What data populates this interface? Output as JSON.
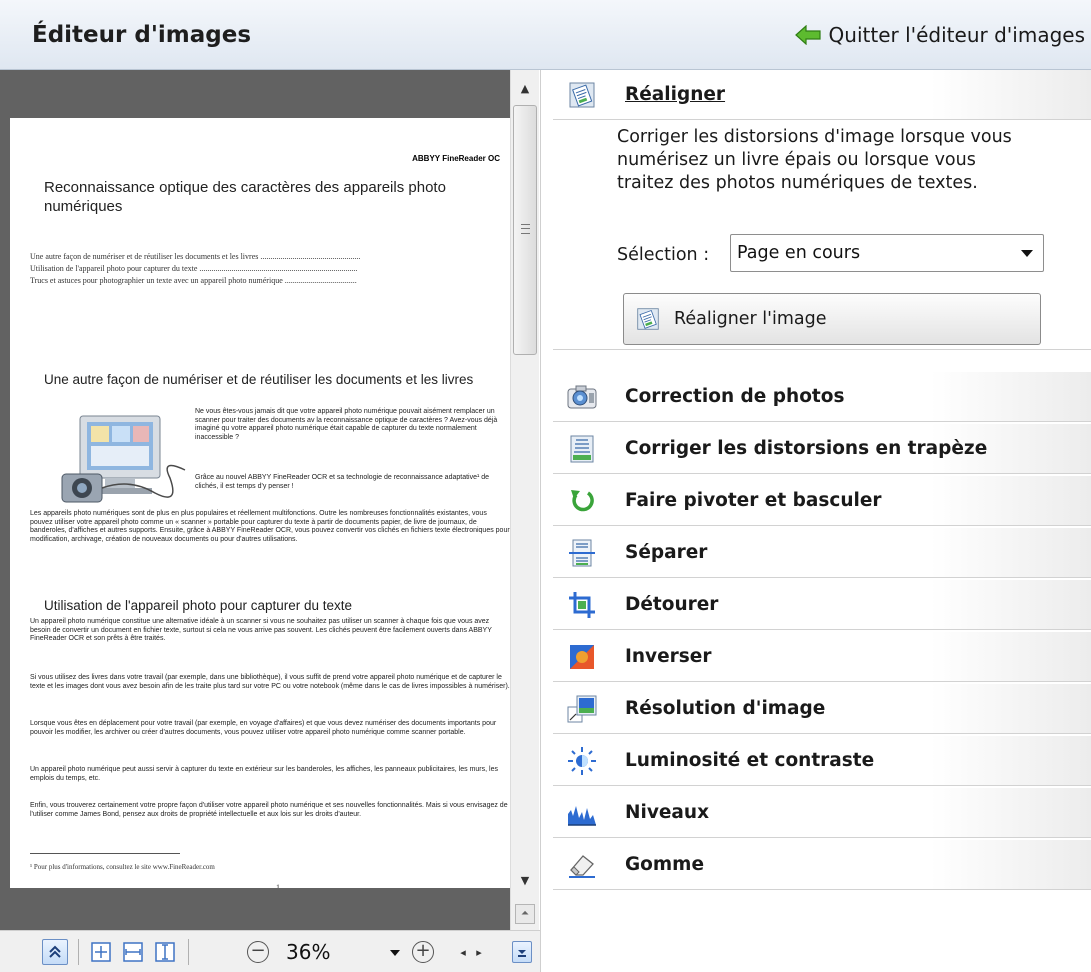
{
  "header": {
    "title": "Éditeur d'images",
    "quit_label": "Quitter l'éditeur d'images"
  },
  "document": {
    "running_head": "ABBYY FineReader OC",
    "title": "Reconnaissance optique des caractères des appareils photo numériques",
    "toc": [
      "Une autre façon de numériser et de réutiliser les documents et les livres ..................................................",
      "Utilisation de l'appareil photo pour capturer du texte ...............................................................................",
      "Trucs et astuces pour photographier un texte avec un appareil photo numérique ...................................."
    ],
    "h1": "Une autre façon de numériser et de réutiliser les documents et les livres",
    "p_intro": "Ne vous êtes-vous jamais dit que votre appareil photo numérique pouvait aisément remplacer un scanner pour traiter des documents av la reconnaissance optique de caractères ? Avez-vous déjà imaginé qu votre appareil photo numérique était capable de capturer du texte normalement inaccessible ?",
    "p_abbyy": "Grâce au nouvel ABBYY FineReader OCR et sa technologie de reconnaissance adaptative¹ de clichés, il est temps d'y penser !",
    "p_cameras": "Les appareils photo numériques sont de plus en plus populaires et réellement multifonctions. Outre les nombreuses fonctionnalités existantes, vous pouvez utiliser votre appareil photo comme un « scanner » portable pour capturer du texte à partir de documents papier, de livre de journaux, de banderoles, d'affiches et autres supports. Ensuite, grâce à ABBYY FineReader OCR, vous pouvez convertir vos clichés en fichiers texte électroniques pour modification, archivage, création de nouveaux documents ou pour d'autres utilisations.",
    "h2": "Utilisation de l'appareil photo pour capturer du texte",
    "p_alt": "Un appareil photo numérique constitue une alternative idéale à un scanner si vous ne souhaitez pas utiliser un scanner à chaque fois que vous avez besoin de convertir un document en fichier texte, surtout si cela ne vous arrive pas souvent. Les clichés peuvent être facilement ouverts dans ABBYY FineReader OCR et son prêts à être traités.",
    "p_books": "Si vous utilisez des livres dans votre travail (par exemple, dans une bibliothèque), il vous suffit de prend votre appareil photo numérique et de capturer le texte et les images dont vous avez besoin afin de les traite plus tard sur votre PC ou votre notebook (même dans le cas de livres impossibles à numériser).",
    "p_travel": "Lorsque vous êtes en déplacement pour votre travail (par exemple, en voyage d'affaires) et que vous devez numériser des documents importants pour pouvoir les modifier, les archiver ou créer d'autres documents, vous pouvez utiliser votre appareil photo numérique comme scanner portable.",
    "p_outdoor": "Un appareil photo numérique peut aussi servir à capturer du texte en extérieur sur les banderoles, les affiches, les panneaux publicitaires, les murs, les emplois du temps, etc.",
    "p_bond": "Enfin, vous trouverez certainement votre propre façon d'utiliser votre appareil photo numérique et ses nouvelles fonctionnalités. Mais si vous envisagez de l'utiliser comme James Bond, pensez aux droits de propriété intellectuelle et aux lois sur les droits d'auteur.",
    "footnote": "¹ Pour plus d'informations, consultez le site www.FineReader.com",
    "page_number": "1"
  },
  "toolbar": {
    "zoom": "36%"
  },
  "panel": {
    "expanded": {
      "title": "Réaligner",
      "description": "Corriger les distorsions d'image lorsque vous numérisez un livre épais ou lorsque vous traitez des photos numériques de textes.",
      "selection_label": "Sélection :",
      "selection_value": "Page en cours",
      "action_label": "Réaligner l'image"
    },
    "sections": [
      {
        "label": "Correction de photos",
        "icon": "camera-icon"
      },
      {
        "label": "Corriger les distorsions en trapèze",
        "icon": "trapezoid-icon"
      },
      {
        "label": "Faire pivoter et basculer",
        "icon": "rotate-icon"
      },
      {
        "label": "Séparer",
        "icon": "split-icon"
      },
      {
        "label": "Détourer",
        "icon": "crop-icon"
      },
      {
        "label": "Inverser",
        "icon": "invert-icon"
      },
      {
        "label": "Résolution d'image",
        "icon": "resolution-icon"
      },
      {
        "label": "Luminosité et contraste",
        "icon": "brightness-icon"
      },
      {
        "label": "Niveaux",
        "icon": "levels-icon"
      },
      {
        "label": "Gomme",
        "icon": "eraser-icon"
      }
    ]
  },
  "colors": {
    "accent_green": "#3aa43a",
    "preview_background": "#626262",
    "header_gradient_end": "#dfe7f1"
  }
}
